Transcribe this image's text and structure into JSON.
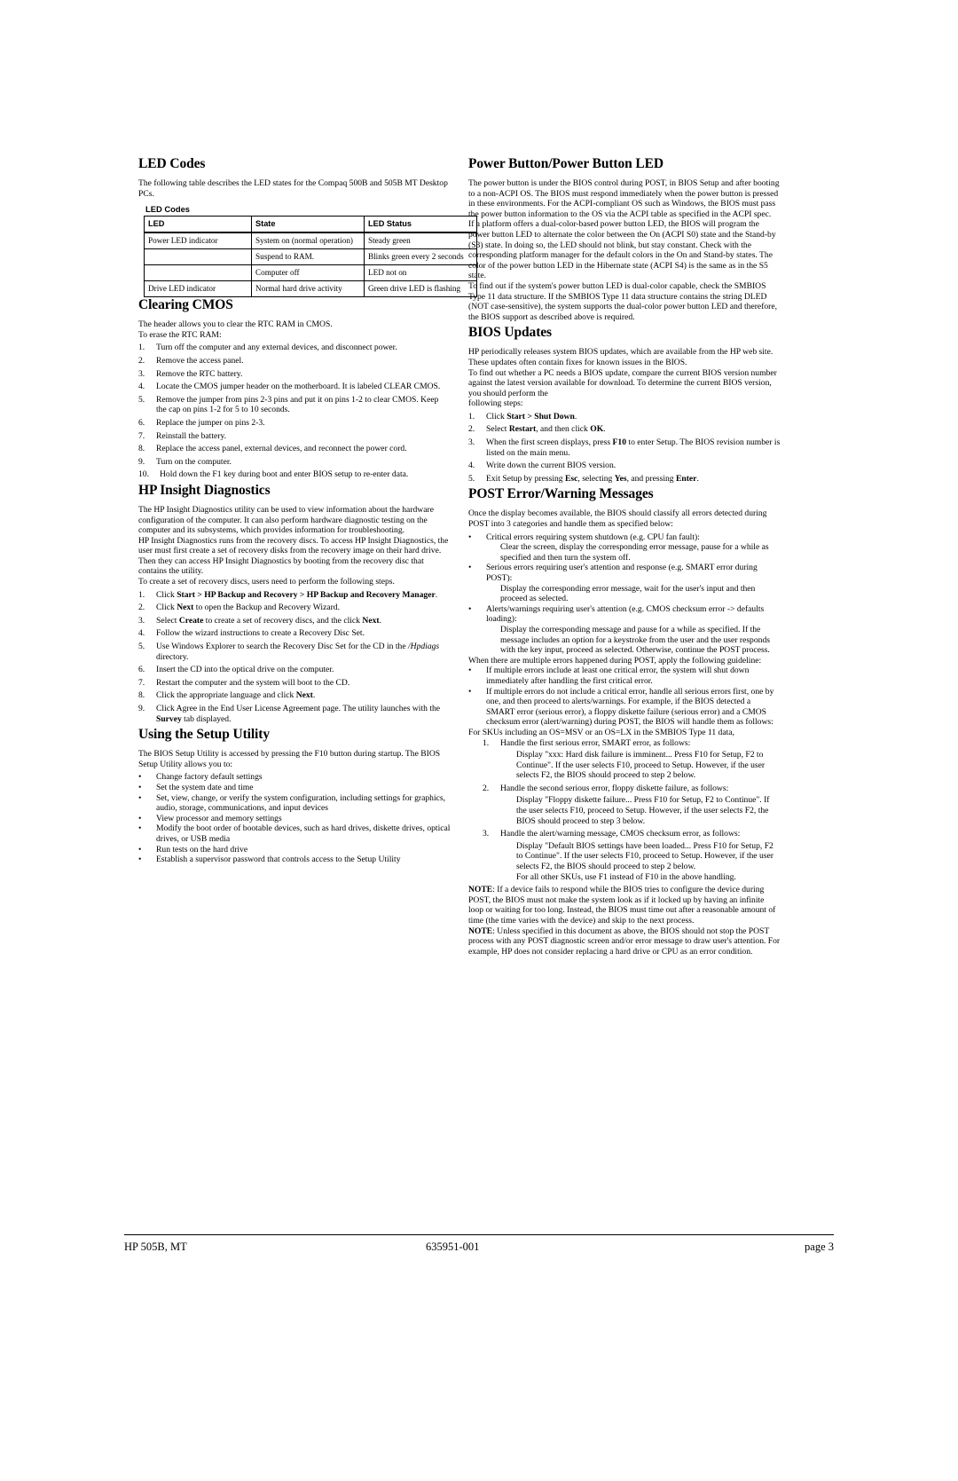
{
  "document": {
    "footer": {
      "left": "HP 505B, MT",
      "center": "635951-001",
      "right": "page 3"
    }
  },
  "left_column": {
    "led_codes": {
      "heading": "LED Codes",
      "intro": "The following table describes the LED states for the Compaq 500B and 505B MT Desktop PCs.",
      "table_caption": "LED Codes",
      "columns": [
        "LED",
        "State",
        "LED Status"
      ],
      "rows": [
        [
          "Power LED indicator",
          "System on (normal operation)",
          "Steady green"
        ],
        [
          "",
          "Suspend to RAM.",
          "Blinks green every 2 seconds"
        ],
        [
          "",
          "Computer off",
          "LED not on"
        ],
        [
          "Drive LED indicator",
          "Normal hard drive activity",
          "Green drive LED is flashing"
        ]
      ]
    },
    "clearing_cmos": {
      "heading": "Clearing CMOS",
      "intro1": "The header allows you to clear the RTC RAM in CMOS.",
      "intro2": "To erase the RTC RAM:",
      "steps": [
        "Turn off the computer and any external devices, and disconnect power.",
        "Remove the access panel.",
        "Remove the RTC battery.",
        "Locate the CMOS jumper header on the motherboard. It is labeled CLEAR CMOS.",
        "Remove the jumper from pins 2-3 pins and put it on pins 1-2 to clear CMOS. Keep the cap on pins 1-2 for 5 to 10 seconds.",
        "Replace the jumper on pins 2-3.",
        "Reinstall the battery.",
        "Replace the access panel, external devices, and reconnect the power cord.",
        "Turn on the computer.",
        "Hold down the F1 key during boot and enter BIOS setup to re-enter data."
      ]
    },
    "hp_insight": {
      "heading": "HP Insight Diagnostics",
      "para1": "The HP Insight Diagnostics utility can be used to view information about the hardware configuration of the computer. It can also perform hardware diagnostic testing on the computer and its subsystems, which provides information for troubleshooting.",
      "para2": "HP Insight Diagnostics runs from the recovery discs. To access HP Insight Diagnostics, the user must first create a set of recovery disks from the recovery image on their hard drive. Then they can access HP Insight Diagnostics by booting from the recovery disc that contains the utility.",
      "para3": "To create a set of recovery discs, users need to perform the following steps.",
      "steps": [
        {
          "pre": "Click ",
          "bold": "Start > HP Backup and Recovery > HP Backup and Recovery Manager",
          "post": "."
        },
        {
          "pre": "Click ",
          "bold": "Next",
          "post": " to open the Backup and Recovery Wizard."
        },
        {
          "pre": "Select ",
          "bold": "Create",
          "post": " to create a set of recovery discs, and the click ",
          "bold2": "Next",
          "post2": "."
        },
        {
          "pre": "Follow the wizard instructions to create a Recovery Disc Set.",
          "bold": "",
          "post": ""
        },
        {
          "pre": "Use Windows Explorer to search the Recovery Disc Set for the CD in the ",
          "italic": "/Hpdiags",
          "post": " directory."
        },
        {
          "pre": "Insert the CD into the optical drive on the computer.",
          "bold": "",
          "post": ""
        },
        {
          "pre": "Restart the computer and the system will boot to the CD.",
          "bold": "",
          "post": ""
        },
        {
          "pre": "Click the appropriate language and click ",
          "bold": "Next",
          "post": "."
        },
        {
          "pre": "Click Agree in the End User License Agreement page. The utility launches with the ",
          "bold": "Survey",
          "post": " tab displayed."
        }
      ]
    },
    "setup_utility": {
      "heading": "Using the Setup Utility",
      "intro": "The BIOS Setup Utility is accessed by pressing the F10 button during startup. The BIOS Setup Utility allows you to:",
      "bullets": [
        "Change factory default settings",
        "Set the system date and time",
        "Set, view, change, or verify the system configuration, including settings for graphics, audio, storage, communications, and input devices",
        "View processor and memory settings",
        "Modify the boot order of bootable devices, such as hard drives, diskette drives, optical drives, or USB media",
        "Run tests on the hard drive",
        "Establish a supervisor password that controls access to the Setup Utility"
      ]
    }
  },
  "right_column": {
    "power_button": {
      "heading": "Power Button/Power Button LED",
      "para1": "The power button is under the BIOS control during POST, in BIOS Setup and after booting to a non-ACPI OS. The BIOS must respond immediately when the power button is pressed in these environments. For the ACPI-compliant OS such as Windows, the BIOS must pass the power button information to the OS via the ACPI table as specified in the ACPI spec.",
      "para2": "If a platform offers a dual-color-based power button LED, the BIOS will program the power button LED to alternate the color between the On (ACPI S0) state and the Stand-by (S3) state. In doing so, the LED should not blink, but stay constant. Check with the corresponding platform manager for the default colors in the On and Stand-by states. The color of the power button LED in the Hibernate state (ACPI S4) is the same as in the S5 state.",
      "para3": "To find out if the system's power button LED is dual-color capable, check the SMBIOS Type 11 data structure. If the SMBIOS Type 11 data structure contains the string DLED (NOT case-sensitive), the system supports the dual-color power button LED and therefore, the BIOS support as described above is required."
    },
    "bios_updates": {
      "heading": "BIOS Updates",
      "para1": "HP periodically releases system BIOS updates, which are available from the HP web site. These updates often contain fixes for known issues in the BIOS.",
      "para2": "To find out whether a PC needs a BIOS update, compare the current BIOS version number against the latest version available for download. To determine the current BIOS version, you should perform the",
      "para3": "following steps:",
      "steps": [
        {
          "pre": "Click ",
          "bold": "Start > Shut Down",
          "post": "."
        },
        {
          "pre": "Select ",
          "bold": "Restart",
          "post": ", and then click ",
          "bold2": "OK",
          "post2": "."
        },
        {
          "pre": "When the first screen displays, press ",
          "bold": "F10",
          "post": " to enter Setup. The BIOS revision number is listed on the main menu."
        },
        {
          "pre": "Write down the current BIOS version.",
          "bold": "",
          "post": ""
        },
        {
          "pre": "Exit Setup by pressing ",
          "bold": "Esc",
          "post": ", selecting ",
          "bold2": "Yes",
          "post2": ", and pressing ",
          "bold3": "Enter",
          "post3": "."
        }
      ]
    },
    "post_errors": {
      "heading": "POST Error/Warning Messages",
      "intro": "Once the display becomes available, the BIOS should classify all errors detected during POST into 3 categories and handle them as specified below:",
      "categories": [
        {
          "bullet": "Critical errors requiring system shutdown (e.g. CPU fan fault):",
          "detail": "Clear the screen, display the corresponding error message, pause for a while as specified and then turn the system off."
        },
        {
          "bullet": "Serious errors requiring user's attention and response (e.g. SMART error during POST):",
          "detail": "Display the corresponding error message, wait for the user's input and then proceed as selected."
        },
        {
          "bullet": "Alerts/warnings requiring user's attention (e.g. CMOS checksum error -> defaults loading):",
          "detail": "Display the corresponding message and pause for a while as specified. If the message includes an option for a keystroke from the user and the user responds with the key input, proceed as selected. Otherwise, continue the POST process."
        }
      ],
      "multi_intro": "When there are multiple errors happened during POST, apply the following guideline:",
      "multi_bullets": [
        "If multiple errors include at least one critical error, the system will shut down immediately after handling the first critical error.",
        "If multiple errors do not include a critical error, handle all serious errors first, one by one, and then proceed to alerts/warnings. For example, if the BIOS detected a SMART error (serious error), a floppy diskette failure (serious error) and a CMOS checksum error (alert/warning) during POST, the BIOS will handle them as follows:"
      ],
      "sku_line": "For SKUs including an OS=MSV or an OS=LX in the SMBIOS Type 11 data,",
      "handling": [
        {
          "num": "1.",
          "title": "Handle the first serious error, SMART error, as follows:",
          "detail": "Display \"xxx: Hard disk failure is imminent... Press F10 for Setup, F2 to Continue\". If the user selects F10, proceed to Setup. However, if the user selects F2, the BIOS should proceed to step 2 below."
        },
        {
          "num": "2.",
          "title": "Handle the second serious error, floppy diskette failure, as follows:",
          "detail": "Display \"Floppy diskette failure... Press F10 for Setup, F2 to Continue\". If the user selects F10, proceed to Setup. However, if the user selects F2, the BIOS should proceed to step 3 below."
        },
        {
          "num": "3.",
          "title": "Handle the alert/warning message, CMOS checksum error, as follows:",
          "detail": "Display \"Default BIOS settings have been loaded... Press F10 for Setup, F2 to Continue\". If the user selects F10, proceed to Setup. However, if the user selects F2, the BIOS should proceed to step 2 below."
        }
      ],
      "all_other_skus": "For all other SKUs, use F1 instead of F10 in the above handling.",
      "note1_label": "NOTE",
      "note1_text": ": If a device fails to respond while the BIOS tries to configure the device during POST, the BIOS must not make the system look as if it locked up by having an infinite loop or waiting for too long. Instead, the BIOS must time out after a reasonable amount of time (the time varies with the device) and skip to the next process.",
      "note2_label": "NOTE",
      "note2_text": ": Unless specified in this document as above, the BIOS should not stop the POST process with any POST diagnostic screen and/or error message to draw user's attention. For example, HP does not consider replacing a hard drive or CPU as an error condition."
    }
  }
}
